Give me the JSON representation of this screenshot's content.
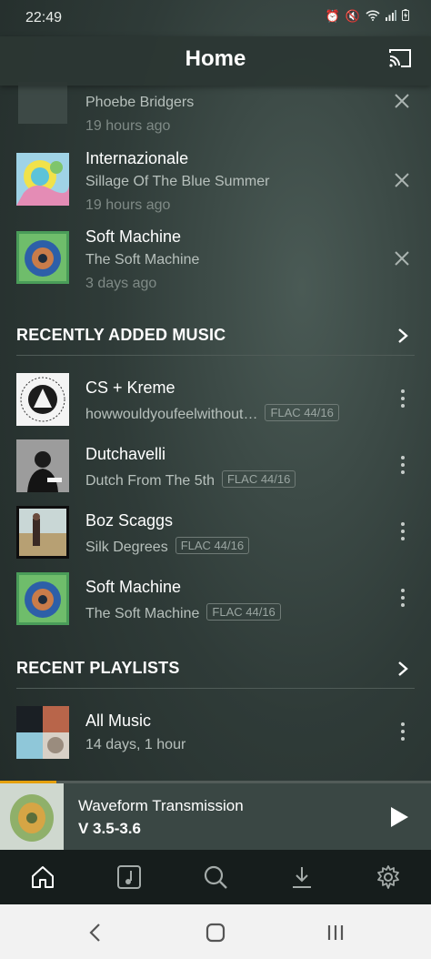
{
  "status": {
    "time": "22:49"
  },
  "header": {
    "title": "Home"
  },
  "history": [
    {
      "artist": "Phoebe Bridgers",
      "time": "19 hours ago"
    },
    {
      "title": "Internazionale",
      "subtitle": "Sillage Of The Blue Summer",
      "time": "19 hours ago"
    },
    {
      "title": "Soft Machine",
      "subtitle": "The Soft Machine",
      "time": "3 days ago"
    }
  ],
  "recently_added": {
    "title": "RECENTLY ADDED MUSIC",
    "items": [
      {
        "title": "CS + Kreme",
        "subtitle": "howwouldyoufeelwithout…",
        "format": "FLAC 44/16"
      },
      {
        "title": "Dutchavelli",
        "subtitle": "Dutch From The 5th",
        "format": "FLAC 44/16"
      },
      {
        "title": "Boz Scaggs",
        "subtitle": "Silk Degrees",
        "format": "FLAC 44/16"
      },
      {
        "title": "Soft Machine",
        "subtitle": "The Soft Machine",
        "format": "FLAC 44/16"
      }
    ]
  },
  "recent_playlists": {
    "title": "RECENT PLAYLISTS",
    "items": [
      {
        "title": "All Music",
        "subtitle": "14 days, 1 hour"
      }
    ]
  },
  "now_playing": {
    "title": "Waveform Transmission",
    "subtitle": "V 3.5-3.6",
    "progress": 0.13
  },
  "tabs": [
    "home-icon",
    "music-note-icon",
    "search-icon",
    "download-icon",
    "gear-icon"
  ],
  "colors": {
    "accent": "#e5a00d",
    "background": "#2f3b38"
  }
}
